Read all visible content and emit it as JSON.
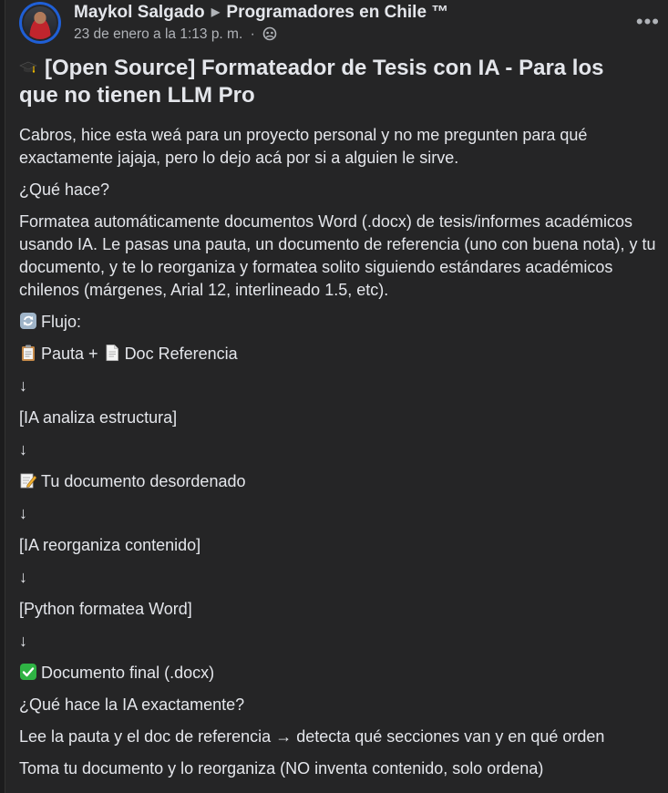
{
  "post": {
    "author": "Maykol Salgado",
    "group": "Programadores en Chile ™",
    "timestamp": "23 de enero a la 1:13 p. m.",
    "meta_separator": "·",
    "more_label": "•••",
    "title": "[Open Source] Formateador de Tesis con IA - Para los que no tienen LLM Pro",
    "paragraphs": {
      "p1": "Cabros, hice esta weá para un proyecto personal y no me pregunten para qué exactamente jajaja, pero lo dejo acá por si a alguien le sirve.",
      "p2": "¿Qué hace?",
      "p3": "Formatea automáticamente documentos Word (.docx) de tesis/informes académicos usando IA. Le pasas una pauta, un documento de referencia (uno con buena nota), y tu documento, y te lo reorganiza y formatea solito siguiendo estándares académicos chilenos (márgenes, Arial 12, interlineado 1.5, etc).",
      "flujo": "Flujo:",
      "pauta": "Pauta + ",
      "doc_ref": "Doc Referencia",
      "arrow": "↓",
      "ia_analiza": "[IA analiza estructura]",
      "tu_doc": "Tu documento desordenado",
      "ia_reorg": "[IA reorganiza contenido]",
      "python": "[Python formatea Word]",
      "doc_final": "Documento final (.docx)",
      "q_ia": "¿Qué hace la IA exactamente?",
      "lee": "Lee la pauta y el doc de referencia → detecta qué secciones van y en qué orden",
      "toma": "Toma tu documento y lo reorganiza (NO inventa contenido, solo ordena)"
    }
  },
  "icons": {
    "more": "more-options-icon",
    "globe": "public-globe-icon",
    "graduation_cap": "graduation-cap-icon",
    "cycle": "cycle-arrows-icon",
    "clipboard": "clipboard-icon",
    "page": "page-document-icon",
    "memo": "memo-pencil-icon",
    "check": "green-check-icon"
  },
  "colors": {
    "background": "#252526",
    "text": "#e4e6eb",
    "secondary": "#b0b3b8",
    "avatar_ring": "#1f5fd6",
    "check": "#2fb344"
  }
}
